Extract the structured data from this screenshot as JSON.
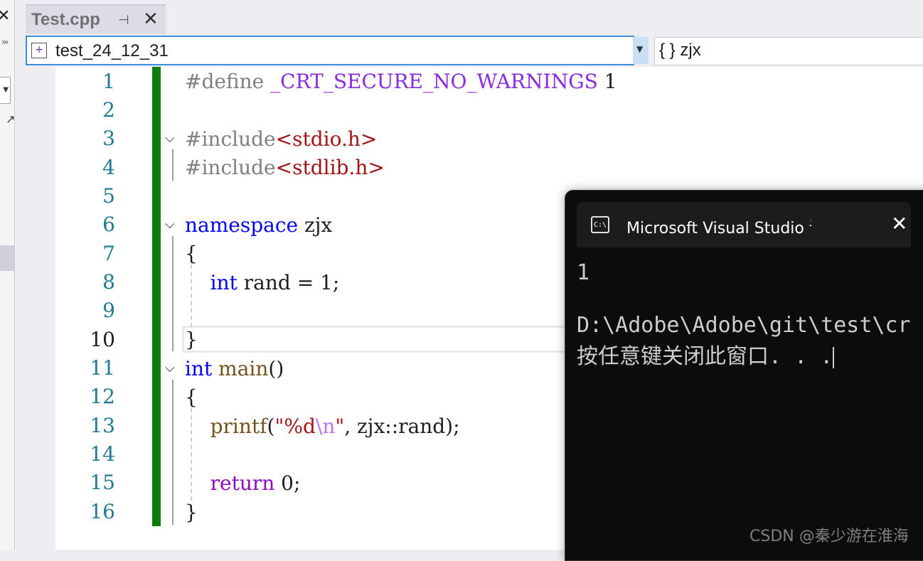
{
  "tab": {
    "title": "Test.cpp",
    "pin_icon": "pin-icon",
    "close_icon": "close-icon"
  },
  "navbar": {
    "scope": "test_24_12_31",
    "member": "{ } zjx"
  },
  "editor": {
    "line_numbers": [
      "1",
      "2",
      "3",
      "4",
      "5",
      "6",
      "7",
      "8",
      "9",
      "10",
      "11",
      "12",
      "13",
      "14",
      "15",
      "16"
    ],
    "current_line": "10",
    "lines": {
      "l1_pp": "#define ",
      "l1_macro": "_CRT_SECURE_NO_WARNINGS",
      "l1_val": " 1",
      "l3_pp": "#include",
      "l3_str": "<stdio.h>",
      "l4_pp": "#include",
      "l4_str": "<stdlib.h>",
      "l6_kw": "namespace",
      "l6_id": " zjx",
      "l7": "{",
      "l8_indent": "    ",
      "l8_kw": "int",
      "l8_rest": " rand = 1;",
      "l10": "}",
      "l11_kw": "int",
      "l11_fn": " main",
      "l11_rest": "()",
      "l12": "{",
      "l13_indent": "    ",
      "l13_fn": "printf",
      "l13_open": "(",
      "l13_str1": "\"%d",
      "l13_esc": "\\n",
      "l13_str2": "\"",
      "l13_rest": ", zjx::rand);",
      "l15_indent": "    ",
      "l15_kw": "return",
      "l15_rest": " 0;",
      "l16": "}"
    }
  },
  "console": {
    "title": "Microsoft Visual Studio 调试控制台",
    "line1": "1",
    "line2": "D:\\Adobe\\Adobe\\git\\test\\cr",
    "line3": "按任意键关闭此窗口. . ."
  },
  "watermark": "CSDN @秦少游在淮海",
  "colors": {
    "change_bar": "#107c10",
    "keyword": "#0000ff",
    "keyword_control": "#8f08c4",
    "macro": "#8a2be2",
    "string": "#a31515",
    "line_number": "#237893",
    "console_bg": "#0c0c0c"
  }
}
